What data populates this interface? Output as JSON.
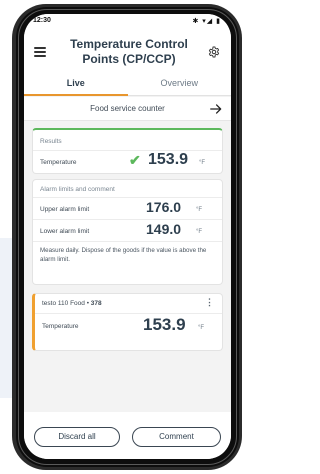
{
  "status_bar": {
    "time": "12:30",
    "icons": "✱ ▾◢ ▮"
  },
  "app_bar": {
    "title": "Temperature Control Points (CP/CCP)"
  },
  "tabs": [
    {
      "label": "Live",
      "active": true
    },
    {
      "label": "Overview",
      "active": false
    }
  ],
  "location": {
    "label": "Food service counter"
  },
  "results": {
    "header": "Results",
    "label": "Temperature",
    "value": "153.9",
    "unit": "°F",
    "status_color": "#5cb85c"
  },
  "alarm": {
    "header": "Alarm limits and comment",
    "upper_label": "Upper alarm limit",
    "upper_value": "176.0",
    "upper_unit": "°F",
    "lower_label": "Lower alarm limit",
    "lower_value": "149.0",
    "lower_unit": "°F",
    "comment": "Measure daily. Dispose of the goods if the value is above the alarm limit."
  },
  "sensor": {
    "name": "testo 110 Food",
    "id": "378",
    "label": "Temperature",
    "value": "153.9",
    "unit": "°F",
    "accent_color": "#f0a030"
  },
  "actions": {
    "discard_label": "Discard all",
    "comment_label": "Comment"
  },
  "colors": {
    "tab_indicator": "#e8962e",
    "primary_text": "#2e3f4e"
  }
}
